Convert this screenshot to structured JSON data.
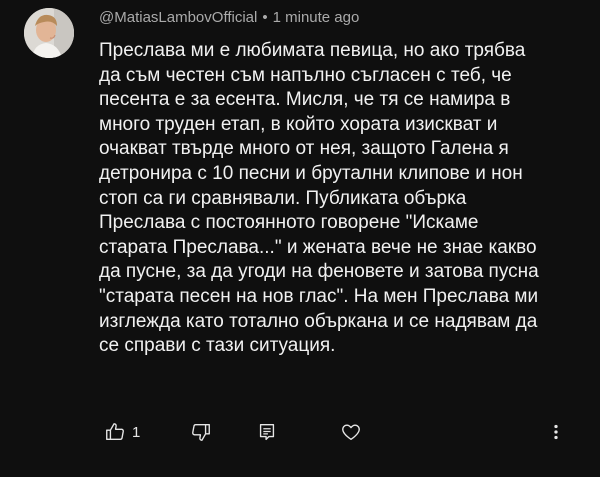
{
  "comment": {
    "author": "@MatiasLambovOfficial",
    "separator": "•",
    "timestamp": "1 minute ago",
    "text_lines": [
      "Преслава ми е любимата певица, но ако трябва",
      "да съм честен съм напълно съгласен с теб, че",
      "песента е за есента. Мисля, че тя се намира в",
      "много труден етап, в който хората изискват и",
      "очакват твърде много от нея, защото Галена я",
      "детронира с 10 песни и брутални клипове и нон",
      "стоп са ги сравнявали. Публиката обърка",
      "Преслава с постоянното говорене \"Искаме",
      "старата Преслава...\" и жената вече не знае какво",
      "да пусне, за да угоди на феновете и затова пусна",
      "\"старата песен на нов глас\". На мен Преслава ми",
      "изглежда като тотално объркана и се надявам да",
      "се справи с тази ситуация."
    ],
    "like_count": "1"
  },
  "icons": {
    "avatar": "user-avatar-photo",
    "like": "thumbs-up-icon",
    "dislike": "thumbs-down-icon",
    "reply": "reply-comment-icon",
    "heart": "heart-icon",
    "more": "more-vertical-icon"
  },
  "colors": {
    "background": "#0f0f0f",
    "text": "#f1f1f1",
    "meta": "#aaaaaa"
  }
}
